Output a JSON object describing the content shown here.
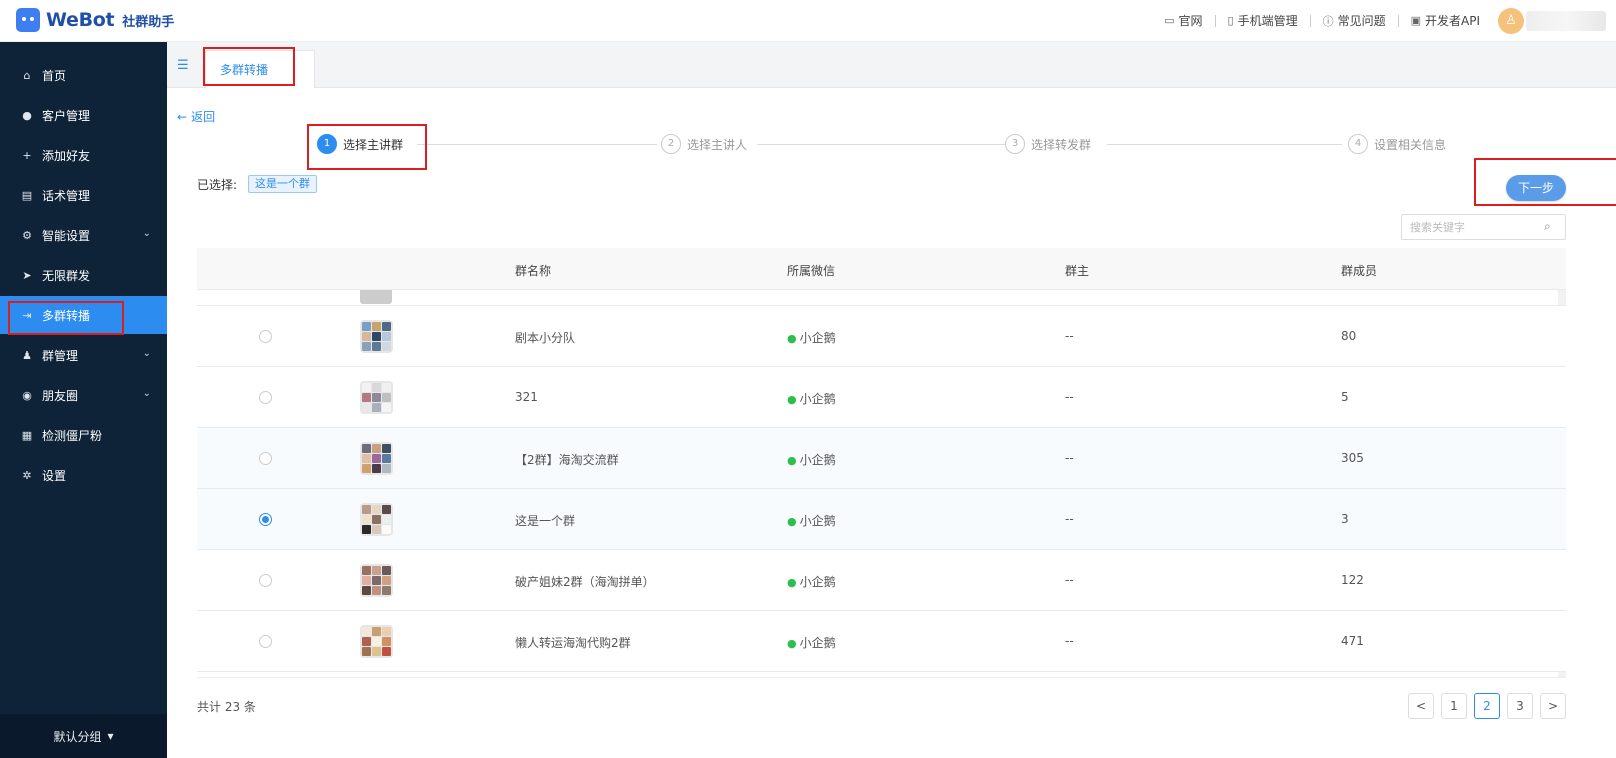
{
  "header": {
    "logo_text": "WeBot",
    "logo_sub": "社群助手",
    "nav": [
      {
        "label": "官网",
        "icon": "monitor-icon"
      },
      {
        "label": "手机端管理",
        "icon": "phone-icon"
      },
      {
        "label": "常见问题",
        "icon": "help-icon"
      },
      {
        "label": "开发者API",
        "icon": "api-icon"
      }
    ]
  },
  "sidebar": {
    "items": [
      {
        "label": "首页",
        "icon": "home-icon"
      },
      {
        "label": "客户管理",
        "icon": "user-icon"
      },
      {
        "label": "添加好友",
        "icon": "add-user-icon"
      },
      {
        "label": "话术管理",
        "icon": "document-icon"
      },
      {
        "label": "智能设置",
        "icon": "settings-icon"
      },
      {
        "label": "无限群发",
        "icon": "send-icon"
      },
      {
        "label": "多群转播",
        "icon": "broadcast-icon"
      },
      {
        "label": "群管理",
        "icon": "group-icon"
      },
      {
        "label": "朋友圈",
        "icon": "moments-icon"
      },
      {
        "label": "检测僵尸粉",
        "icon": "monitor-chart-icon"
      },
      {
        "label": "设置",
        "icon": "gear-icon"
      }
    ],
    "active_index": 6,
    "footer_label": "默认分组"
  },
  "tabs": {
    "active_label": "多群转播"
  },
  "page": {
    "back_label": "返回",
    "steps": [
      {
        "num": "1",
        "label": "选择主讲群"
      },
      {
        "num": "2",
        "label": "选择主讲人"
      },
      {
        "num": "3",
        "label": "选择转发群"
      },
      {
        "num": "4",
        "label": "设置相关信息"
      }
    ],
    "active_step": 0,
    "selected_label": "已选择:",
    "selected_tag": "这是一个群",
    "next_label": "下一步",
    "search_placeholder": "搜索关键字"
  },
  "table": {
    "columns": [
      "群名称",
      "所属微信",
      "群主",
      "群成员"
    ],
    "rows": [
      {
        "name": "剧本小分队",
        "wechat": "小企鹅",
        "owner": "--",
        "members": "80",
        "selected": false
      },
      {
        "name": "321",
        "wechat": "小企鹅",
        "owner": "--",
        "members": "5",
        "selected": false
      },
      {
        "name": "【2群】海淘交流群",
        "wechat": "小企鹅",
        "owner": "--",
        "members": "305",
        "selected": false
      },
      {
        "name": "这是一个群",
        "wechat": "小企鹅",
        "owner": "--",
        "members": "3",
        "selected": true
      },
      {
        "name": "破产姐妹2群（海淘拼单）",
        "wechat": "小企鹅",
        "owner": "--",
        "members": "122",
        "selected": false
      },
      {
        "name": "懒人转运海淘代购2群",
        "wechat": "小企鹅",
        "owner": "--",
        "members": "471",
        "selected": false
      }
    ]
  },
  "pagination": {
    "total_label": "共计 23 条",
    "prev": "<",
    "next": ">",
    "pages": [
      "1",
      "2",
      "3"
    ],
    "current_page": "2"
  },
  "colors": {
    "accent": "#2d8cf0",
    "sidebar_bg": "#0e2238",
    "highlight": "#d9201f",
    "wechat_green": "#2cbf4e"
  }
}
